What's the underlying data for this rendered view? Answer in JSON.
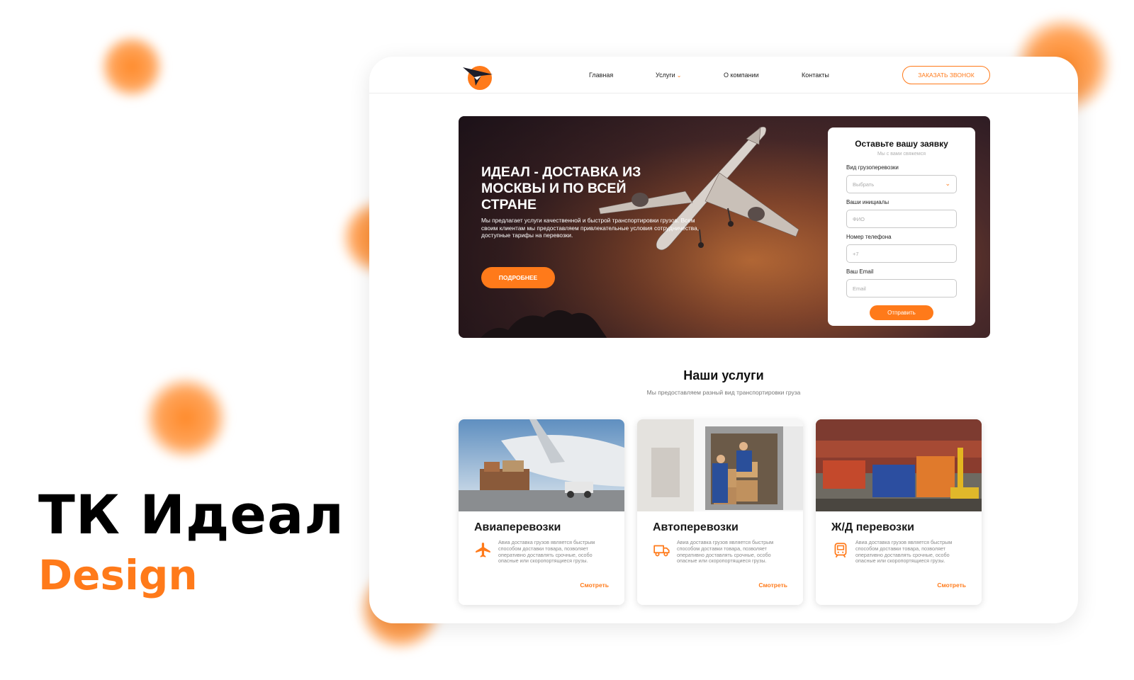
{
  "brand": {
    "title": "ТК Идеал",
    "subtitle": "Design"
  },
  "colors": {
    "accent": "#ff7a1a",
    "text": "#1a1a1a",
    "muted": "#8a8a8a"
  },
  "header": {
    "nav": [
      {
        "label": "Главная"
      },
      {
        "label": "Услуги",
        "icon": "chevron-down-icon"
      },
      {
        "label": "О компании"
      },
      {
        "label": "Контакты"
      }
    ],
    "callback_button": "ЗАКАЗАТЬ ЗВОНОК"
  },
  "hero": {
    "title": "ИДЕАЛ - ДОСТАВКА ИЗ МОСКВЫ И ПО ВСЕЙ СТРАНЕ",
    "text": "Мы предлагает услуги качественной и быстрой транспортировки грузов. Всем своим клиентам мы предоставляем привлекательные условия сотрудничества, доступные тарифы на перевозки.",
    "button": "ПОДРОБНЕЕ"
  },
  "form": {
    "title": "Оставьте вашу заявку",
    "subtitle": "Мы с вами свяжемся",
    "fields": [
      {
        "label": "Вид грузоперевозки",
        "placeholder": "Выбрать"
      },
      {
        "label": "Ваши инициалы",
        "placeholder": "ФИО"
      },
      {
        "label": "Номер телефона",
        "placeholder": "+7"
      },
      {
        "label": "Ваш Email",
        "placeholder": "Email"
      }
    ],
    "submit": "Отправить"
  },
  "services": {
    "title": "Наши услуги",
    "subtitle": "Мы предоставляем разный вид транспортировки груза",
    "cards": [
      {
        "title": "Авиаперевозки",
        "icon": "plane-icon",
        "desc": "Авиа доставка грузов является быстрым способом доставки товара, позволяет оперативно доставлять срочные, особо опасные или скоропортящиеся грузы.",
        "link": "Смотреть"
      },
      {
        "title": "Автоперевозки",
        "icon": "truck-icon",
        "desc": "Авиа доставка грузов является быстрым способом доставки товара, позволяет оперативно доставлять срочные, особо опасные или скоропортящиеся грузы.",
        "link": "Смотреть"
      },
      {
        "title": "Ж/Д перевозки",
        "icon": "train-icon",
        "desc": "Авиа доставка грузов является быстрым способом доставки товара, позволяет оперативно доставлять срочные, особо опасные или скоропортящиеся грузы.",
        "link": "Смотреть"
      }
    ]
  }
}
